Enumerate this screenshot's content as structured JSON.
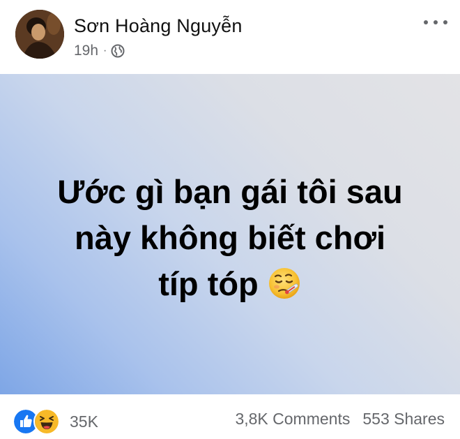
{
  "post": {
    "author": "Sơn Hoàng Nguyễn",
    "time": "19h",
    "separator": "·",
    "privacy_icon": "globe-icon",
    "more_icon": "more-horizontal-icon",
    "status_lines": [
      "Ước gì bạn gái tôi sau",
      "này không biết chơi",
      "típ tóp"
    ],
    "status_emoji": "face-with-thermometer-emoji",
    "background_gradient": [
      "#7ea6e6",
      "#e3e3e6"
    ]
  },
  "footer": {
    "reaction_icons": [
      "like-icon",
      "haha-icon"
    ],
    "reaction_count": "35K",
    "comments": "3,8K Comments",
    "shares": "553 Shares"
  },
  "colors": {
    "like_blue": "#1877f2",
    "haha_yellow": "#f7b928",
    "meta_gray": "#65676b"
  }
}
